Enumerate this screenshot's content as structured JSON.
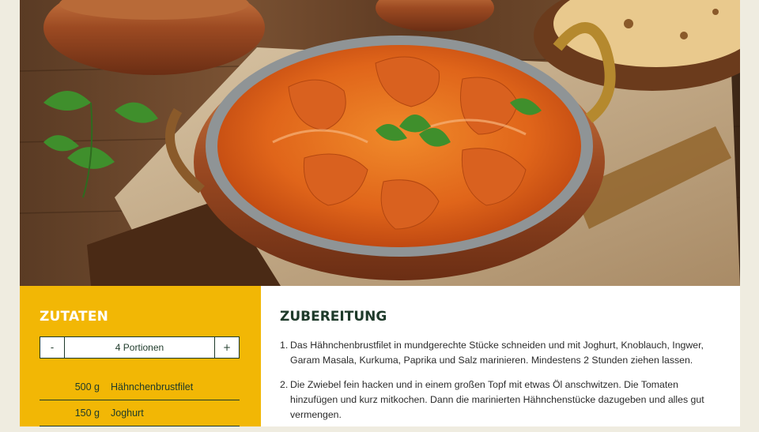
{
  "ingredients": {
    "title": "ZUTATEN",
    "stepper": {
      "minus": "-",
      "value": "4 Portionen",
      "plus": "+"
    },
    "items": [
      {
        "amount": "500 g",
        "name": "Hähnchenbrustfilet"
      },
      {
        "amount": "150 g",
        "name": "Joghurt"
      }
    ]
  },
  "preparation": {
    "title": "ZUBEREITUNG",
    "steps": [
      {
        "num": "1.",
        "text": "Das Hähnchenbrustfilet in mundgerechte Stücke schneiden und mit Joghurt, Knoblauch, Ingwer, Garam Masala, Kurkuma, Paprika und Salz marinieren. Mindestens 2 Stunden ziehen lassen."
      },
      {
        "num": "2.",
        "text": "Die Zwiebel fein hacken und in einem großen Topf mit etwas Öl anschwitzen. Die Tomaten hinzufügen und kurz mitkochen. Dann die marinierten Hähnchenstücke dazugeben und alles gut vermengen."
      }
    ]
  },
  "colors": {
    "page_bg": "#efece0",
    "ingredients_bg": "#f2b705",
    "dark_green": "#1e3a2a",
    "white": "#ffffff"
  }
}
